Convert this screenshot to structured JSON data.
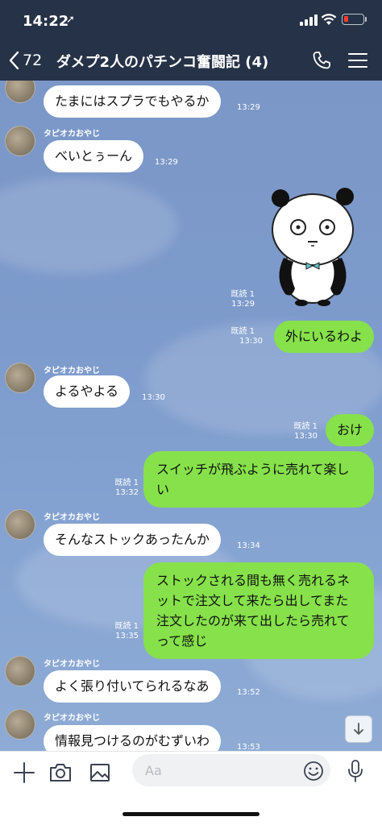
{
  "status_bar": {
    "time": "14:22",
    "location_arrow": "➚"
  },
  "header": {
    "back_count": "72",
    "title": "ダメプ2人のパチンコ奮闘記 (4)"
  },
  "messages": [
    {
      "text": "たまにはスプラでもやるか",
      "time": "13:29"
    },
    {
      "sender": "タピオカおやじ",
      "text": "べいとぅーん",
      "time": "13:29"
    },
    {
      "read": "既読 1",
      "time": "13:29"
    },
    {
      "read": "既読 1",
      "text": "外にいるわよ",
      "time": "13:30"
    },
    {
      "sender": "タピオカおやじ",
      "text": "よるやよる",
      "time": "13:30"
    },
    {
      "read": "既読 1",
      "text": "おけ",
      "time": "13:30"
    },
    {
      "read": "既読 1",
      "text": "スイッチが飛ぶように売れて楽しい",
      "time": "13:32"
    },
    {
      "sender": "タピオカおやじ",
      "text": "そんなストックあったんか",
      "time": "13:34"
    },
    {
      "read": "既読 1",
      "text": "ストックされる間も無く売れるネットで注文して来たら出してまた注文したのが来て出したら売れてって感じ",
      "time": "13:35"
    },
    {
      "sender": "タピオカおやじ",
      "text": "よく張り付いてられるなあ",
      "time": "13:52"
    },
    {
      "sender": "タピオカおやじ",
      "text": "情報見つけるのがむずいわ",
      "time": "13:53"
    }
  ],
  "input": {
    "placeholder": "Aa"
  },
  "colors": {
    "header_bg": "#263247",
    "outgoing_bubble": "#86e14a",
    "incoming_bubble": "#ffffff",
    "chat_bg": "#7d9bcc"
  }
}
